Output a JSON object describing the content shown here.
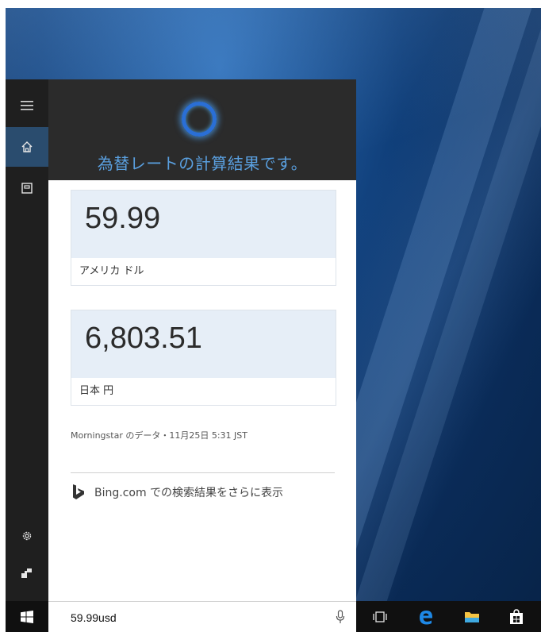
{
  "cortana": {
    "title": "為替レートの計算結果です。"
  },
  "conversion": {
    "from_amount": "59.99",
    "from_currency": "アメリカ ドル",
    "to_amount": "6,803.51",
    "to_currency": "日本 円"
  },
  "source_text": "Morningstar のデータ・11月25日 5:31 JST",
  "bing": {
    "link_text": "Bing.com での検索結果をさらに表示",
    "icon": "bing-logo-icon"
  },
  "rail": {
    "items": [
      {
        "icon": "hamburger-menu-icon"
      },
      {
        "icon": "home-icon"
      },
      {
        "icon": "notebook-icon"
      },
      {
        "icon": "settings-gear-icon"
      },
      {
        "icon": "feedback-icon"
      }
    ]
  },
  "taskbar": {
    "search_value": "59.99usd",
    "icons": [
      "windows-start-icon",
      "microphone-icon",
      "task-view-icon",
      "edge-browser-icon",
      "file-explorer-icon",
      "store-icon"
    ]
  },
  "colors": {
    "accent": "#2a6fd6",
    "header_text": "#5aa0e0",
    "card_fill": "#e6eef7",
    "taskbar": "#101010",
    "rail": "#1f1f1f"
  }
}
